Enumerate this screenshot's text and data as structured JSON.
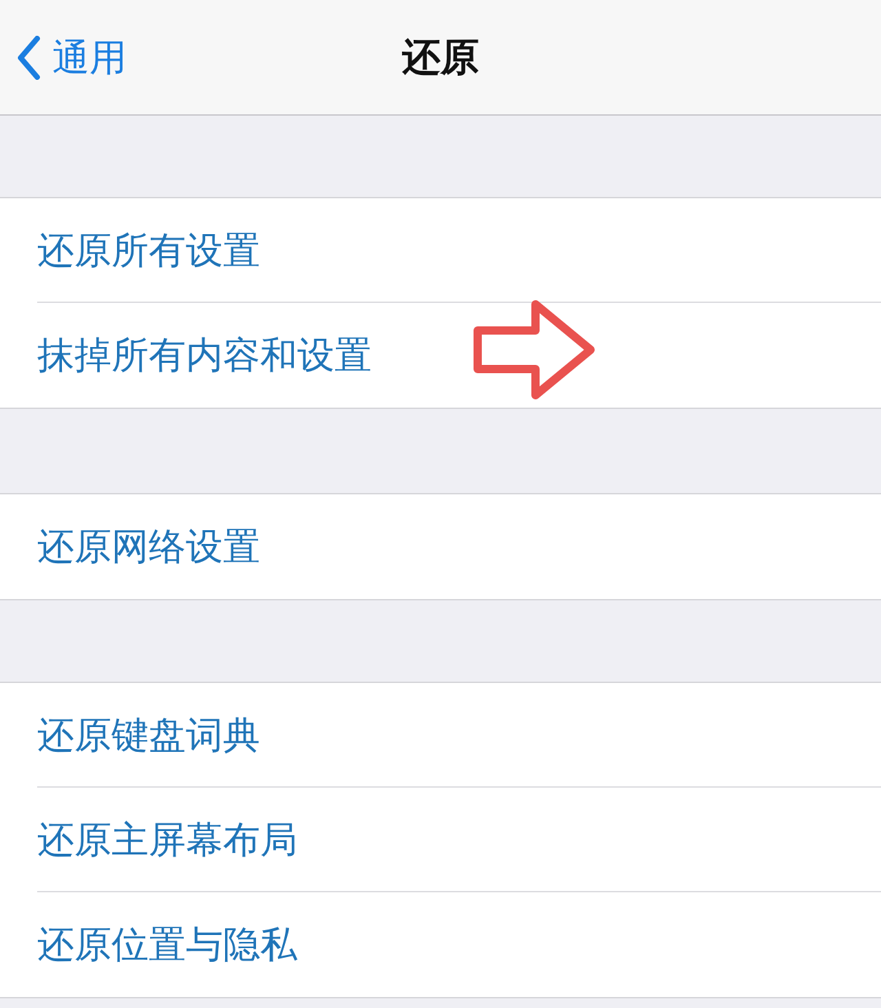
{
  "nav_bar": {
    "back_label": "通用",
    "title": "还原"
  },
  "groups": [
    {
      "items": [
        {
          "label": "还原所有设置"
        },
        {
          "label": "抹掉所有内容和设置"
        }
      ]
    },
    {
      "items": [
        {
          "label": "还原网络设置"
        }
      ]
    },
    {
      "items": [
        {
          "label": "还原键盘词典"
        },
        {
          "label": "还原主屏幕布局"
        },
        {
          "label": "还原位置与隐私"
        }
      ]
    }
  ]
}
